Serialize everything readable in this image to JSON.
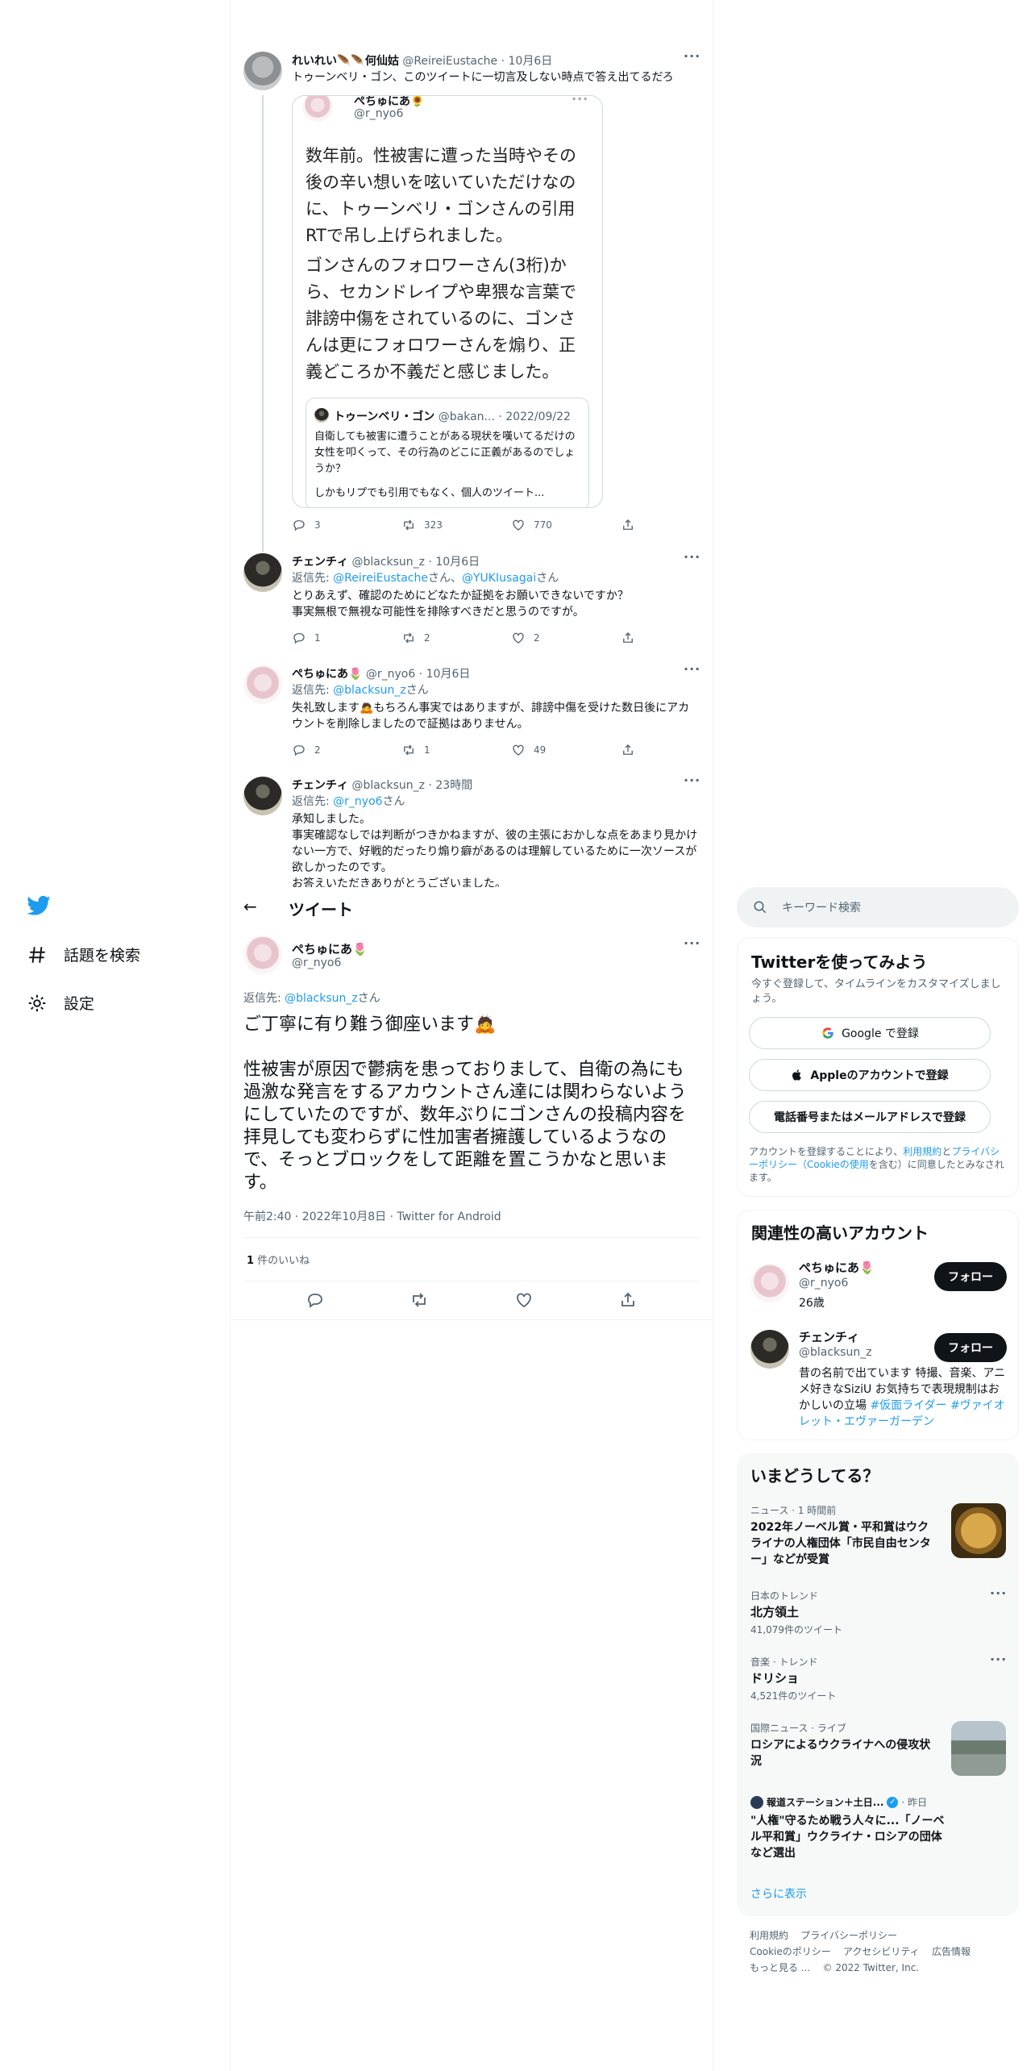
{
  "thread": {
    "reply1": {
      "display_name": "れいれい🪶🪶何仙姑",
      "handle": "@ReireiEustache",
      "sep": "·",
      "date": "10月6日",
      "text": "トゥーンベリ・ゴン、このツイートに一切言及しない時点で答え出てるだろ",
      "quoted": {
        "display_name": "ぺちゅにあ🌻",
        "handle": "@r_nyo6",
        "para1": "数年前。性被害に遭った当時やその後の辛い想いを呟いていただけなのに、トゥーンベリ・ゴンさんの引用RTで吊し上げられました。",
        "para2": "ゴンさんのフォロワーさん(3桁)から、セカンドレイプや卑猥な言葉で誹謗中傷をされているのに、ゴンさんは更にフォロワーさんを煽り、正義どころか不義だと感じました。",
        "nested": {
          "display_name": "トゥーンベリ・ゴン",
          "handle": "@bakan...",
          "date": "· 2022/09/22",
          "text": "自衛しても被害に遭うことがある現状を嘆いてるだけの女性を叩くって、その行為のどこに正義があるのでしょうか？",
          "text2": "しかもリプでも引用でもなく、個人のツイート..."
        }
      },
      "replies": "3",
      "retweets": "323",
      "likes": "770"
    },
    "reply2": {
      "display_name": "チェンチィ",
      "handle": "@blacksun_z",
      "sep": "·",
      "date": "10月6日",
      "reply_prefix": "返信先: ",
      "reply_to_1": "@ReireiEustache",
      "reply_mid": "さん、",
      "reply_to_2": "@YUKIusagai",
      "reply_suffix": "さん",
      "line1": "とりあえず、確認のためにどなたか証拠をお願いできないですか？",
      "line2": "事実無根で無視な可能性を排除すべきだと思うのですが。",
      "replies": "1",
      "retweets": "2",
      "likes": "2"
    },
    "reply3": {
      "display_name": "ぺちゅにあ🌷",
      "handle": "@r_nyo6",
      "sep": "·",
      "date": "10月6日",
      "reply_prefix": "返信先: ",
      "reply_to": "@blacksun_z",
      "reply_suffix": "さん",
      "line1": "失礼致します🙇もちろん事実ではありますが、誹謗中傷を受けた数日後にアカウントを削除しましたので証拠はありません。",
      "replies": "2",
      "retweets": "1",
      "likes": "49"
    },
    "reply4": {
      "display_name": "チェンチィ",
      "handle": "@blacksun_z",
      "sep": "·",
      "date": "23時間",
      "reply_prefix": "返信先: ",
      "reply_to": "@r_nyo6",
      "reply_suffix": "さん",
      "line1": "承知しました。",
      "line2": "事実確認なしでは判断がつきかねますが、彼の主張におかしな点をあまり見かけない一方で、好戦的だったり煽り癖があるのは理解しているために一次ソースが欲しかったのです。",
      "line3": "お答えいただきありがとうございました。"
    }
  },
  "nav": {
    "explore": "話題を検索",
    "settings": "設定"
  },
  "header": {
    "back": "←",
    "title": "ツイート"
  },
  "main": {
    "display_name": "ぺちゅにあ🌷",
    "handle": "@r_nyo6",
    "reply_prefix": "返信先: ",
    "reply_to": "@blacksun_z",
    "reply_suffix": "さん",
    "line1": "ご丁寧に有り難う御座います🙇",
    "line2": "性被害が原因で鬱病を患っておりまして、自衛の為にも過激な発言をするアカウントさん達には関わらないようにしていたのですが、数年ぶりにゴンさんの投稿内容を拝見しても変わらずに性加害者擁護しているようなので、そっとブロックをして距離を置こうかなと思います。",
    "timestamp": "午前2:40 · 2022年10月8日 · Twitter for Android",
    "likes_count": "1",
    "likes_label": " 件のいいね"
  },
  "sidebar": {
    "search_placeholder": "キーワード検索",
    "signup": {
      "title": "Twitterを使ってみよう",
      "subtitle": "今すぐ登録して、タイムラインをカスタマイズしましょう。",
      "google": "Google で登録",
      "apple": "Appleのアカウントで登録",
      "phone": "電話番号またはメールアドレスで登録",
      "terms_1": "アカウントを登録することにより、",
      "terms_link1": "利用規約",
      "terms_2": "と",
      "terms_link2": "プライバシーポリシー（Cookieの使用",
      "terms_3": "を含む）に同意したとみなされます。"
    },
    "relevant": {
      "title": "関連性の高いアカウント",
      "accounts": [
        {
          "name": "ぺちゅにあ🌷",
          "handle": "@r_nyo6",
          "bio": "26歳",
          "follow": "フォロー"
        },
        {
          "name": "チェンチィ",
          "handle": "@blacksun_z",
          "bio": "昔の名前で出ています 特撮、音楽、アニメ好きなSiziU お気持ちで表現規制はおかしいの立場 ",
          "bio_link": "#仮面ライダー #ヴァイオレット・エヴァーガーデン",
          "follow": "フォロー"
        }
      ]
    },
    "trends": {
      "title": "いまどうしてる？",
      "items": [
        {
          "meta": "ニュース · 1 時間前",
          "title": "2022年ノーベル賞・平和賞はウクライナの人権団体「市民自由センター」などが受賞"
        },
        {
          "meta": "日本のトレンド",
          "title": "北方領土",
          "count": "41,079件のツイート"
        },
        {
          "meta": "音楽 · トレンド",
          "title": "ドリショ",
          "count": "4,521件のツイート"
        },
        {
          "meta": "国際ニュース · ライブ",
          "title": "ロシアによるウクライナへの侵攻状況"
        },
        {
          "meta_name": "報道ステーション＋土日...",
          "meta_date": "· 昨日",
          "title": "\"人権\"守るため戦う人々に...「ノーベル平和賞」ウクライナ・ロシアの団体など選出"
        }
      ],
      "more": "さらに表示"
    },
    "footer": {
      "terms": "利用規約",
      "privacy": "プライバシーポリシー",
      "cookie": "Cookieのポリシー",
      "access": "アクセシビリティ",
      "ads": "広告情報",
      "more": "もっと見る ...",
      "copyright": "© 2022 Twitter, Inc."
    }
  },
  "colors": {
    "accent": "#1d9bf0",
    "text": "#0f1419",
    "muted": "#536471",
    "border": "#eff3f4"
  }
}
